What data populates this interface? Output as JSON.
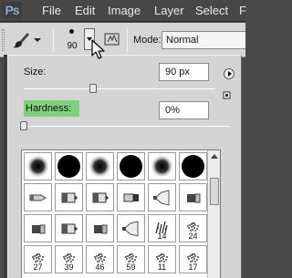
{
  "app": {
    "logo": "Ps"
  },
  "menubar": {
    "items": [
      "File",
      "Edit",
      "Image",
      "Layer",
      "Select",
      "F"
    ]
  },
  "options_bar": {
    "brush_size": "90",
    "mode_label": "Mode:",
    "mode_value": "Normal"
  },
  "brush_picker": {
    "size_label": "Size:",
    "size_value": "90 px",
    "size_fraction": 0.36,
    "hardness_label": "Hardness:",
    "hardness_value": "0%",
    "hardness_fraction": 0.0,
    "highlight_color": "#7cd17a",
    "presets": [
      {
        "kind": "soft",
        "size": ""
      },
      {
        "kind": "hard",
        "size": ""
      },
      {
        "kind": "soft",
        "size": ""
      },
      {
        "kind": "hard",
        "size": ""
      },
      {
        "kind": "soft",
        "size": ""
      },
      {
        "kind": "hard",
        "size": ""
      },
      {
        "kind": "pencil",
        "size": ""
      },
      {
        "kind": "marker",
        "size": ""
      },
      {
        "kind": "marker",
        "size": ""
      },
      {
        "kind": "brush",
        "size": ""
      },
      {
        "kind": "fan",
        "size": ""
      },
      {
        "kind": "flat",
        "size": ""
      },
      {
        "kind": "flat",
        "size": ""
      },
      {
        "kind": "marker",
        "size": ""
      },
      {
        "kind": "flat",
        "size": ""
      },
      {
        "kind": "fan",
        "size": ""
      },
      {
        "kind": "grass",
        "size": "14"
      },
      {
        "kind": "splatter",
        "size": "24"
      },
      {
        "kind": "splatter",
        "size": "27"
      },
      {
        "kind": "splatter",
        "size": "39"
      },
      {
        "kind": "splatter",
        "size": "46"
      },
      {
        "kind": "splatter",
        "size": "59"
      },
      {
        "kind": "splatter",
        "size": "11"
      },
      {
        "kind": "splatter",
        "size": "17"
      }
    ]
  }
}
